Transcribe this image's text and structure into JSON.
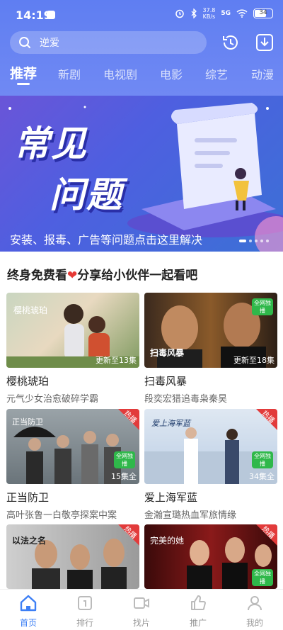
{
  "status_bar": {
    "time": "14:19",
    "network_speed": "37.8",
    "network_unit": "KB/s",
    "signal": "5G",
    "battery": "34"
  },
  "search": {
    "text": "逆爱"
  },
  "tabs": [
    {
      "label": "推荐",
      "active": true
    },
    {
      "label": "新剧"
    },
    {
      "label": "电视剧"
    },
    {
      "label": "电影"
    },
    {
      "label": "综艺"
    },
    {
      "label": "动漫"
    }
  ],
  "banner": {
    "line1": "常见",
    "line2": "问题",
    "caption": "安装、报毒、广告等问题点击这里解决"
  },
  "share": {
    "text_before": "终身免费看",
    "heart": "❤",
    "text_after": "分享给小伙伴一起看吧"
  },
  "cards": [
    {
      "title": "樱桃琥珀",
      "desc": "元气少女治愈破碎学霸",
      "episodes": "更新至13集",
      "poster_text": "樱桃琥珀"
    },
    {
      "title": "扫毒风暴",
      "desc": "段奕宏猎追毒枭秦昊",
      "episodes": "更新至18集",
      "badge": "全网独播",
      "poster_text": "扫毒风暴"
    },
    {
      "title": "正当防卫",
      "desc": "高叶张鲁一白敬亭探案中案",
      "episodes": "15集全",
      "hot": "热播",
      "badge": "全网独播",
      "poster_text": "正当防卫"
    },
    {
      "title": "爱上海军蓝",
      "desc": "金瀚宣璐热血军旅情缘",
      "episodes": "34集全",
      "hot": "热播",
      "badge": "全网独播",
      "poster_text": "爱上海军蓝"
    },
    {
      "title": "",
      "desc": "",
      "episodes": "",
      "hot": "热播",
      "poster_text": "以法之名"
    },
    {
      "title": "",
      "desc": "",
      "episodes": "",
      "hot": "热播",
      "badge": "全网独播",
      "poster_text": "完美的她"
    }
  ],
  "bottom_nav": [
    {
      "label": "首页",
      "icon": "home-icon",
      "active": true
    },
    {
      "label": "排行",
      "icon": "rank-icon"
    },
    {
      "label": "找片",
      "icon": "video-icon"
    },
    {
      "label": "推广",
      "icon": "thumb-up-icon"
    },
    {
      "label": "我的",
      "icon": "user-icon"
    }
  ],
  "colors": {
    "accent": "#3d7ff5",
    "header": "#6381f2",
    "hot": "#e23b3b",
    "full_badge": "#2fb84a"
  }
}
